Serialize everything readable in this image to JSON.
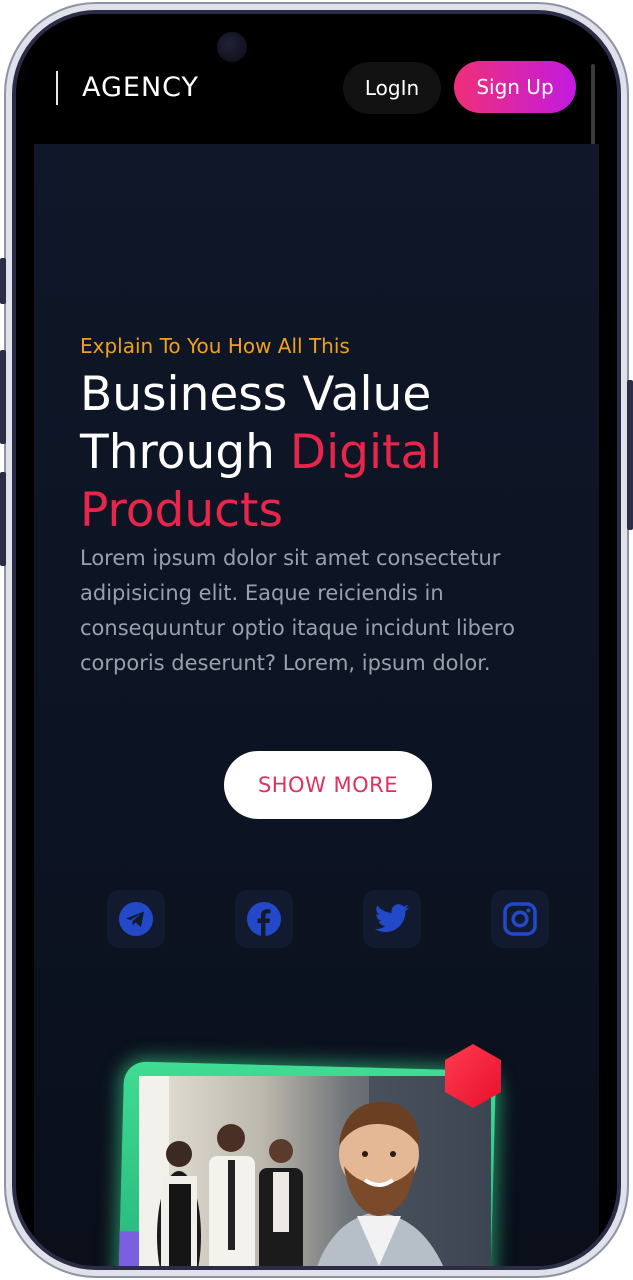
{
  "nav": {
    "brand": "AGENCY",
    "login_label": "LogIn",
    "signup_label": "Sign Up"
  },
  "hero": {
    "eyebrow": "Explain To You How All This",
    "headline_part1": "Business Value Through ",
    "headline_accent": "Digital Products",
    "body": "Lorem ipsum dolor sit amet consectetur adipisicing elit. Eaque reiciendis in consequuntur optio itaque incidunt libero corporis deserunt? Lorem, ipsum dolor.",
    "cta_label": "SHOW MORE"
  },
  "social": [
    {
      "icon": "telegram-icon"
    },
    {
      "icon": "facebook-icon"
    },
    {
      "icon": "twitter-icon"
    },
    {
      "icon": "instagram-icon"
    }
  ],
  "colors": {
    "eyebrow": "#f0a01e",
    "accent": "#e8254a",
    "signup_gradient_start": "#ef2f77",
    "signup_gradient_end": "#c21be0",
    "social_icon": "#2449c8",
    "hero_bg": "#0f1728",
    "photo_frame": "#3fdc92",
    "hexagon": "#f11c3a"
  }
}
